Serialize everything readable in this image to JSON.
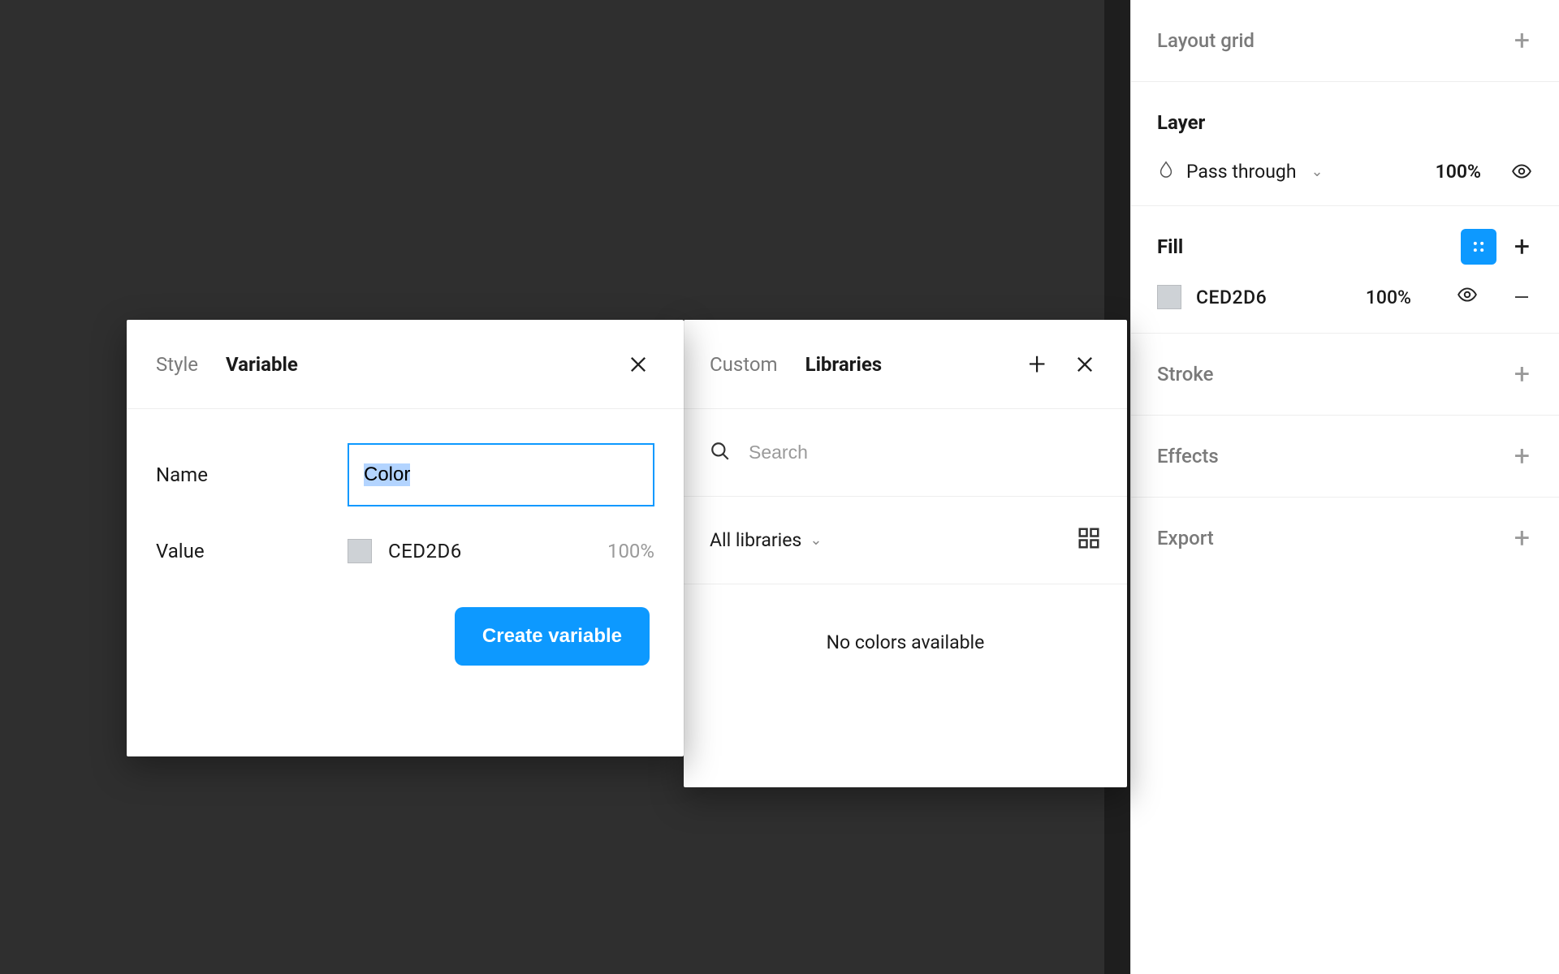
{
  "inspector": {
    "layout_grid": {
      "title": "Layout grid"
    },
    "layer": {
      "title": "Layer",
      "blend_mode": "Pass through",
      "opacity": "100%"
    },
    "fill": {
      "title": "Fill",
      "hex": "CED2D6",
      "opacity": "100%",
      "swatch_color": "#CED2D6"
    },
    "stroke": {
      "title": "Stroke"
    },
    "effects": {
      "title": "Effects"
    },
    "export": {
      "title": "Export"
    }
  },
  "libraries_panel": {
    "tabs": {
      "custom": "Custom",
      "libraries": "Libraries"
    },
    "search_placeholder": "Search",
    "filter_label": "All libraries",
    "empty_text": "No colors available"
  },
  "variable_dialog": {
    "tabs": {
      "style": "Style",
      "variable": "Variable"
    },
    "name_label": "Name",
    "name_value": "Color",
    "value_label": "Value",
    "value_hex": "CED2D6",
    "value_opacity": "100%",
    "submit_label": "Create variable",
    "swatch_color": "#CED2D6"
  },
  "colors": {
    "accent": "#0d99ff",
    "swatch": "#CED2D6"
  }
}
